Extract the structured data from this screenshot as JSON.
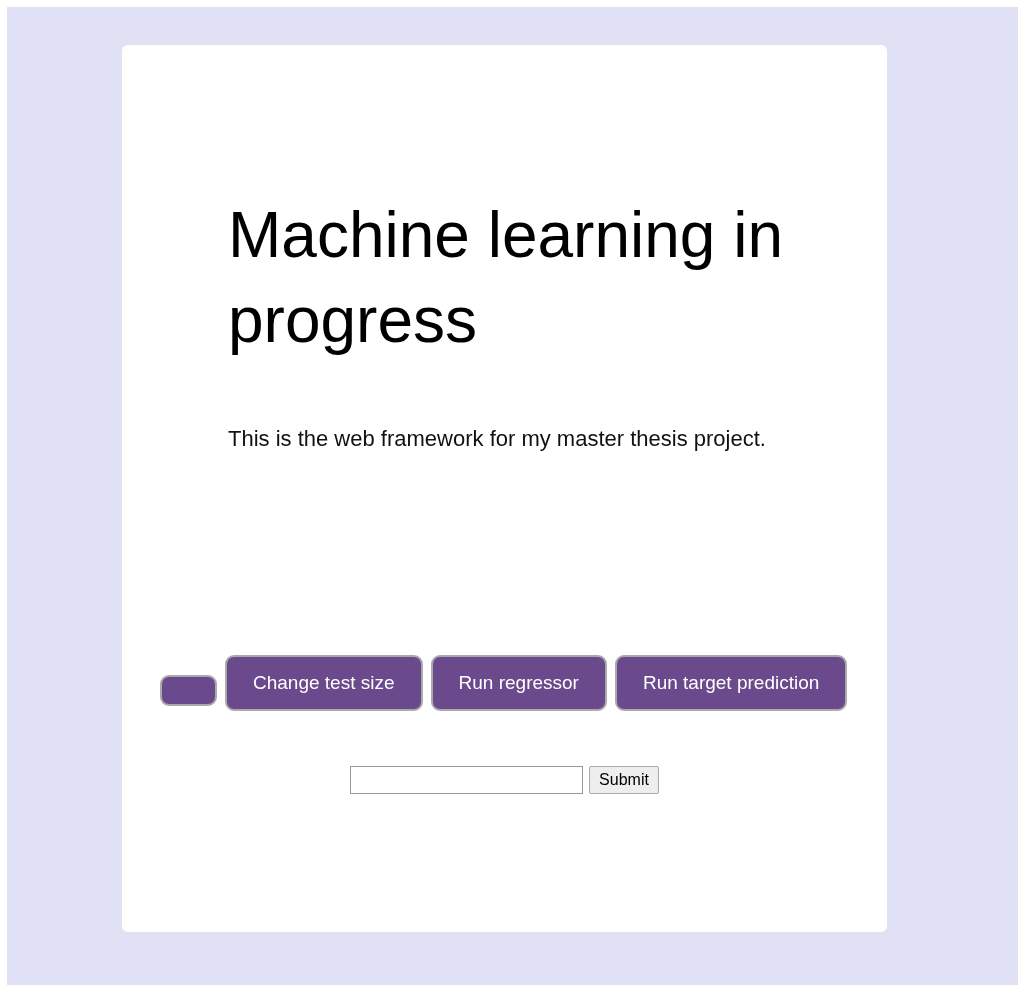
{
  "title": "Machine learning in progress",
  "description": "This is the web framework for my master thesis project.",
  "buttons": [
    {
      "kind": "blank"
    },
    {
      "kind": "text",
      "label": "Change test size"
    },
    {
      "kind": "text",
      "label": "Run regressor"
    },
    {
      "kind": "text",
      "label": "Run target prediction"
    }
  ],
  "form": {
    "submit": "Submit"
  }
}
